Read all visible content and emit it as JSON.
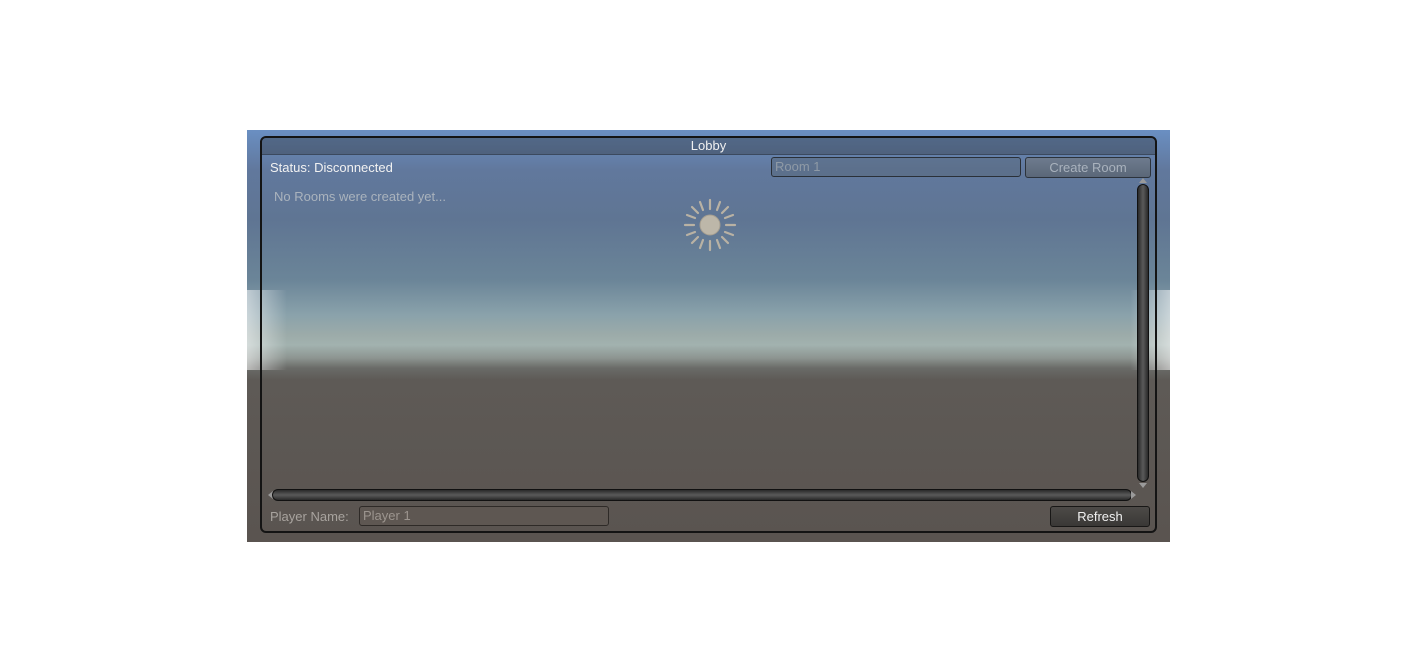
{
  "window": {
    "title": "Lobby"
  },
  "status": {
    "text": "Status: Disconnected"
  },
  "create_room": {
    "room_name_placeholder": "Room 1",
    "button_label": "Create Room"
  },
  "room_list": {
    "empty_message": "No Rooms were created yet..."
  },
  "player": {
    "label": "Player Name:",
    "name_placeholder": "Player 1"
  },
  "refresh": {
    "button_label": "Refresh"
  },
  "scene": {
    "icon": "sun-icon",
    "sky_color": "#61789d",
    "ground_color": "#5a5450"
  }
}
